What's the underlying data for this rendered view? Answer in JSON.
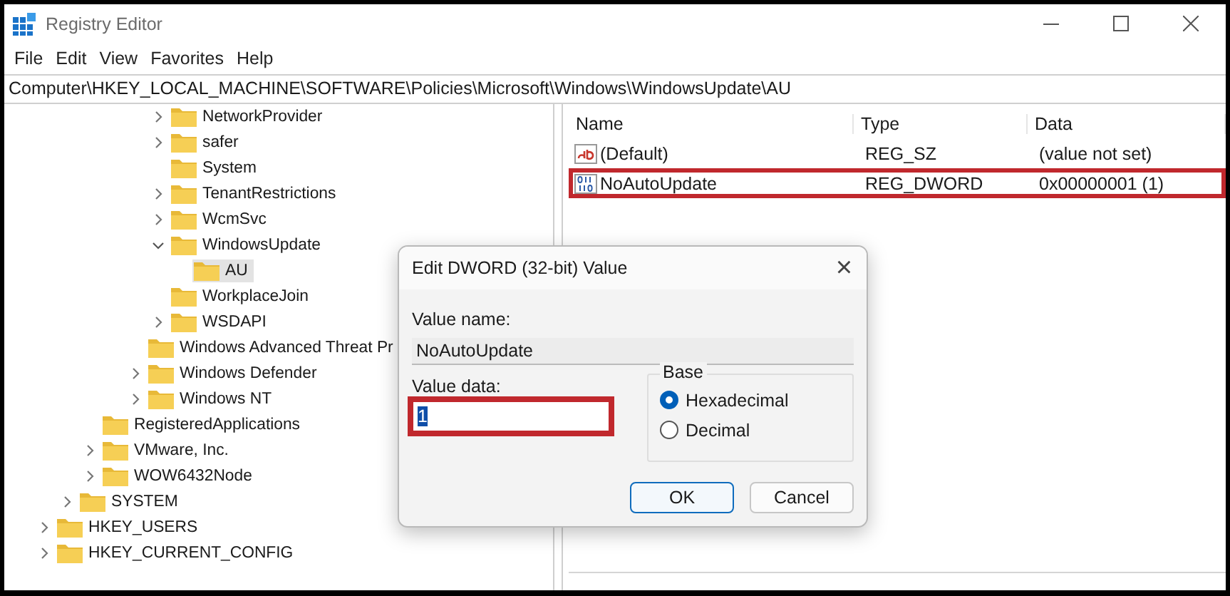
{
  "window": {
    "title": "Registry Editor"
  },
  "menu": [
    "File",
    "Edit",
    "View",
    "Favorites",
    "Help"
  ],
  "address": "Computer\\HKEY_LOCAL_MACHINE\\SOFTWARE\\Policies\\Microsoft\\Windows\\WindowsUpdate\\AU",
  "tree": {
    "items": [
      {
        "children": [
          {
            "children": [
              {
                "children": [
                  {
                    "children": [
                      {
                        "children": [
                          {
                            "label": "NetworkProvider",
                            "leaf": false,
                            "expanded": false,
                            "selected": false
                          },
                          {
                            "label": "safer",
                            "leaf": false,
                            "expanded": false,
                            "selected": false
                          },
                          {
                            "label": "System",
                            "leaf": true,
                            "expanded": false,
                            "selected": false
                          },
                          {
                            "label": "TenantRestrictions",
                            "leaf": false,
                            "expanded": false,
                            "selected": false
                          },
                          {
                            "label": "WcmSvc",
                            "leaf": false,
                            "expanded": false,
                            "selected": false
                          },
                          {
                            "label": "WindowsUpdate",
                            "leaf": false,
                            "expanded": true,
                            "selected": false,
                            "children": [
                              {
                                "label": "AU",
                                "leaf": true,
                                "expanded": false,
                                "selected": true
                              }
                            ]
                          },
                          {
                            "label": "WorkplaceJoin",
                            "leaf": true,
                            "expanded": false,
                            "selected": false
                          },
                          {
                            "label": "WSDAPI",
                            "leaf": false,
                            "expanded": false,
                            "selected": false
                          }
                        ]
                      },
                      {
                        "label": "Windows Advanced Threat Pr",
                        "leaf": true,
                        "expanded": false,
                        "selected": false
                      },
                      {
                        "label": "Windows Defender",
                        "leaf": false,
                        "expanded": false,
                        "selected": false
                      },
                      {
                        "label": "Windows NT",
                        "leaf": false,
                        "expanded": false,
                        "selected": false
                      }
                    ]
                  }
                ]
              },
              {
                "label": "RegisteredApplications",
                "leaf": true,
                "expanded": false,
                "selected": false
              },
              {
                "label": "VMware, Inc.",
                "leaf": false,
                "expanded": false,
                "selected": false
              },
              {
                "label": "WOW6432Node",
                "leaf": false,
                "expanded": false,
                "selected": false
              }
            ]
          },
          {
            "label": "SYSTEM",
            "leaf": false,
            "expanded": false,
            "selected": false
          }
        ]
      },
      {
        "label": "HKEY_USERS",
        "leaf": false,
        "expanded": false,
        "selected": false
      },
      {
        "label": "HKEY_CURRENT_CONFIG",
        "leaf": false,
        "expanded": false,
        "selected": false
      }
    ]
  },
  "values": {
    "columns": [
      "Name",
      "Type",
      "Data"
    ],
    "rows": [
      {
        "kind": "string",
        "name": "(Default)",
        "type": "REG_SZ",
        "data": "(value not set)",
        "highlighted": false
      },
      {
        "kind": "binary",
        "name": "NoAutoUpdate",
        "type": "REG_DWORD",
        "data": "0x00000001 (1)",
        "highlighted": true
      }
    ]
  },
  "dialog": {
    "title": "Edit DWORD (32-bit) Value",
    "close": "×",
    "value_name_label": "Value name:",
    "value_name": "NoAutoUpdate",
    "value_data_label": "Value data:",
    "value_data": "1",
    "value_data_highlighted": true,
    "base_label": "Base",
    "base_options": [
      {
        "label": "Hexadecimal",
        "selected": true
      },
      {
        "label": "Decimal",
        "selected": false
      }
    ],
    "buttons": [
      {
        "label": "OK",
        "default": true
      },
      {
        "label": "Cancel",
        "default": false
      }
    ]
  }
}
